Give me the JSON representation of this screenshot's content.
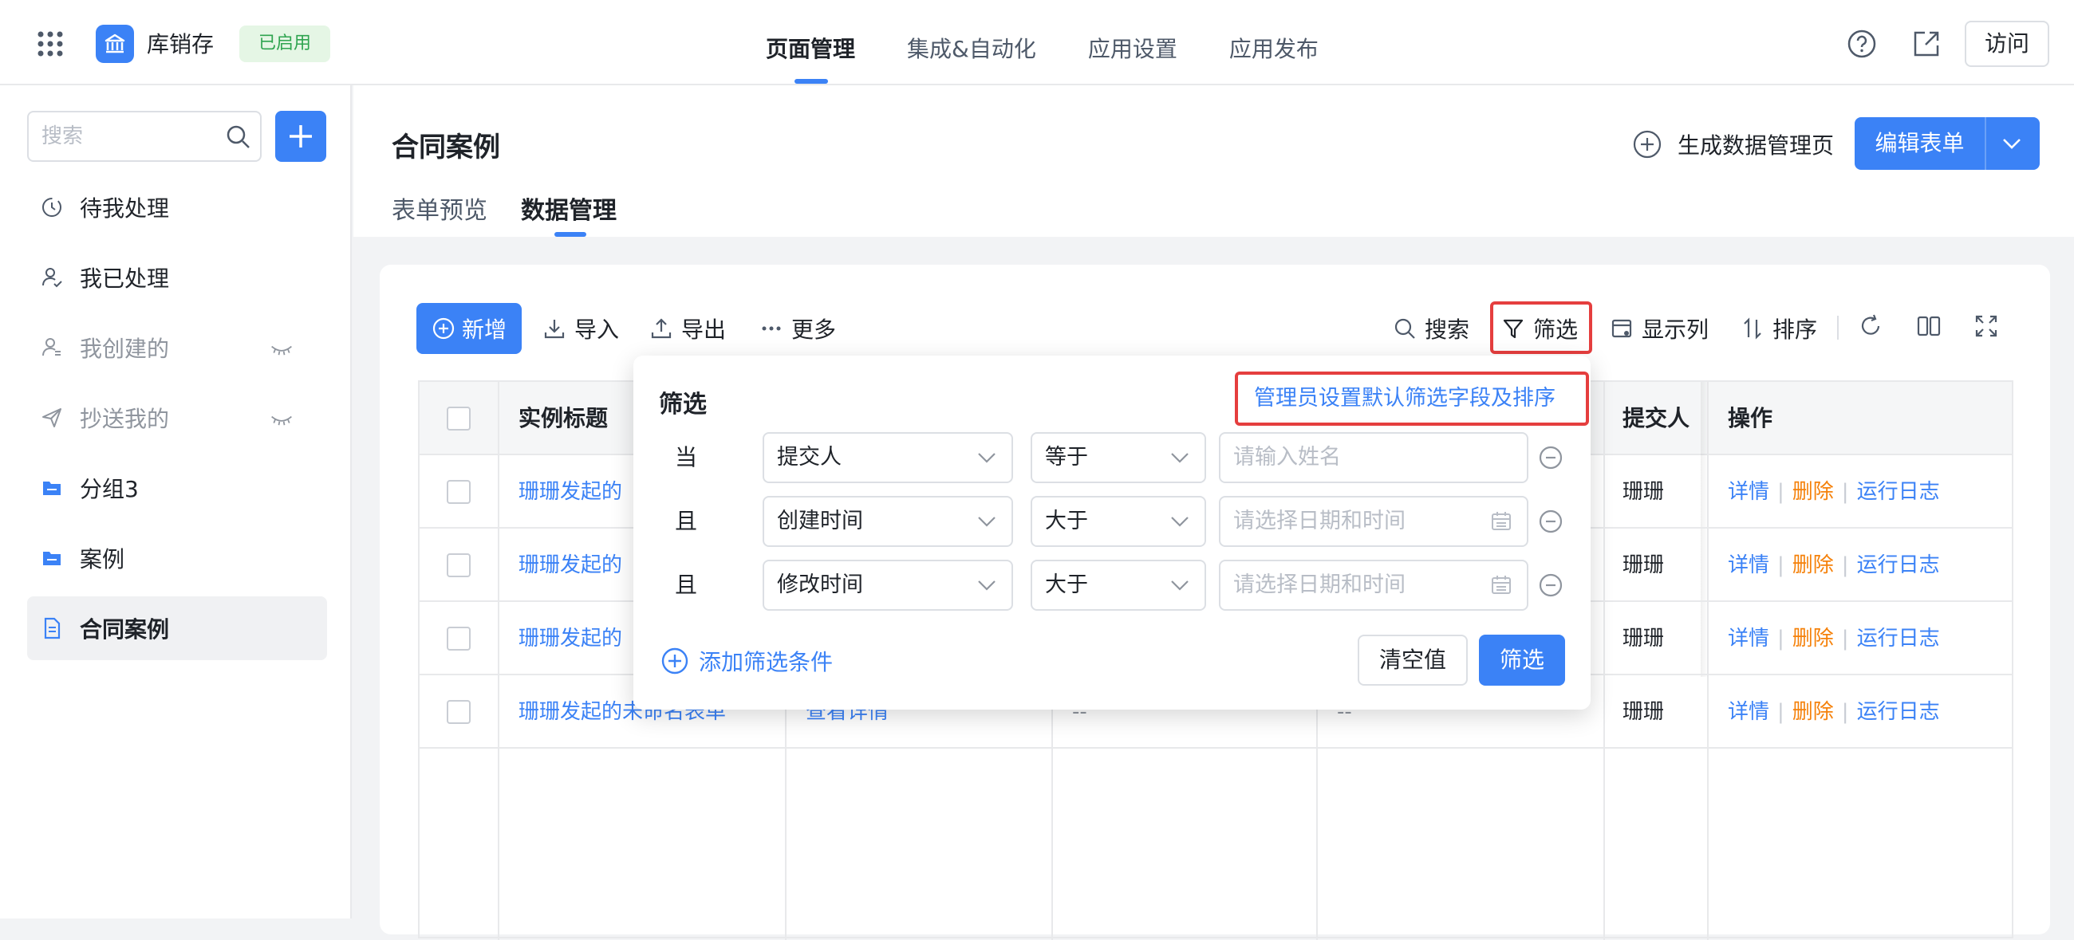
{
  "topbar": {
    "app_name": "库销存",
    "status_badge": "已启用",
    "nav": [
      "页面管理",
      "集成&自动化",
      "应用设置",
      "应用发布"
    ],
    "visit_label": "访问"
  },
  "sidebar": {
    "search_placeholder": "搜索",
    "items": [
      {
        "label": "待我处理",
        "icon": "clock-icon"
      },
      {
        "label": "我已处理",
        "icon": "user-check-icon"
      },
      {
        "label": "我创建的",
        "icon": "user-icon",
        "hidden": true
      },
      {
        "label": "抄送我的",
        "icon": "send-icon",
        "hidden": true
      },
      {
        "label": "分组3",
        "icon": "folder-icon"
      },
      {
        "label": "案例",
        "icon": "folder-icon"
      },
      {
        "label": "合同案例",
        "icon": "document-icon",
        "active": true
      }
    ]
  },
  "header": {
    "title": "合同案例",
    "tabs": [
      "表单预览",
      "数据管理"
    ],
    "generate_label": "生成数据管理页",
    "edit_label": "编辑表单"
  },
  "toolbar": {
    "add_label": "新增",
    "import_label": "导入",
    "export_label": "导出",
    "more_label": "更多",
    "search_label": "搜索",
    "filter_label": "筛选",
    "columns_label": "显示列",
    "sort_label": "排序"
  },
  "table": {
    "columns": [
      "实例标题",
      "提交人",
      "操作"
    ],
    "rows": [
      {
        "title": "珊珊发起的",
        "submitter": "珊珊"
      },
      {
        "title": "珊珊发起的",
        "submitter": "珊珊"
      },
      {
        "title": "珊珊发起的",
        "submitter": "珊珊"
      },
      {
        "title": "珊珊发起的未命名表单",
        "extra": "查看详情",
        "c3": "--",
        "c4": "--",
        "submitter": "珊珊"
      }
    ],
    "ops": {
      "detail": "详情",
      "delete": "删除",
      "log": "运行日志"
    }
  },
  "filter_popover": {
    "title": "筛选",
    "admin_link": "管理员设置默认筛选字段及排序",
    "conditions": [
      {
        "conj": "当",
        "field": "提交人",
        "op": "等于",
        "placeholder": "请输入姓名",
        "date": false
      },
      {
        "conj": "且",
        "field": "创建时间",
        "op": "大于",
        "placeholder": "请选择日期和时间",
        "date": true
      },
      {
        "conj": "且",
        "field": "修改时间",
        "op": "大于",
        "placeholder": "请选择日期和时间",
        "date": true
      }
    ],
    "add_condition_label": "添加筛选条件",
    "clear_label": "清空值",
    "apply_label": "筛选"
  },
  "colors": {
    "primary": "#3b82f6",
    "danger": "#f5810a",
    "success": "#2ea44f",
    "highlight": "#e53e3e"
  }
}
